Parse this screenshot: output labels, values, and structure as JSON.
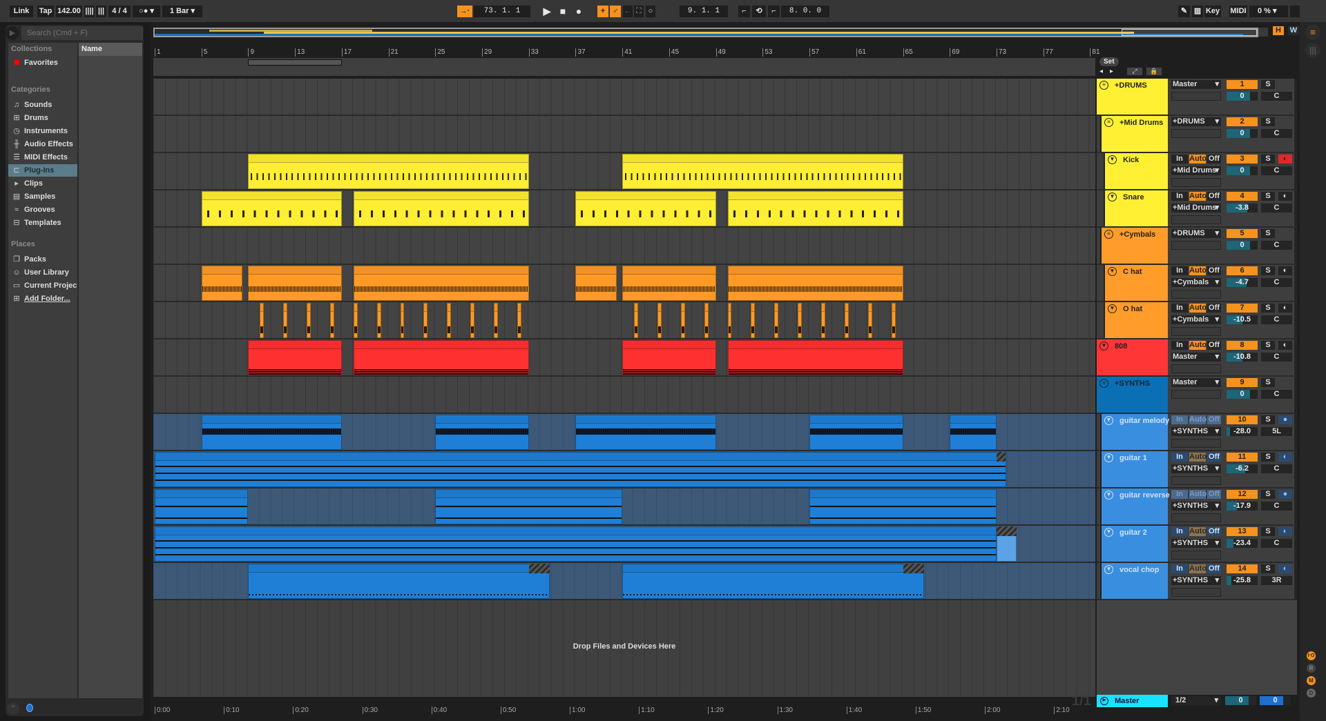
{
  "transport": {
    "link": "Link",
    "tap": "Tap",
    "tempo": "142.00",
    "sig": "4 / 4",
    "metro": "○●",
    "quant": "1 Bar",
    "position": "73.  1.  1",
    "loop_start": "9.  1.  1",
    "loop_length": "8.  0.  0",
    "key": "Key",
    "midi": "MIDI",
    "cpu": "0 %"
  },
  "browser": {
    "search_placeholder": "Search (Cmd + F)",
    "collections_heading": "Collections",
    "favorites": "Favorites",
    "categories_heading": "Categories",
    "categories": [
      {
        "label": "Sounds",
        "icon": "music-note-icon"
      },
      {
        "label": "Drums",
        "icon": "drum-grid-icon"
      },
      {
        "label": "Instruments",
        "icon": "instrument-icon"
      },
      {
        "label": "Audio Effects",
        "icon": "audio-effects-icon"
      },
      {
        "label": "MIDI Effects",
        "icon": "midi-effects-icon"
      },
      {
        "label": "Plug-Ins",
        "icon": "plugin-icon",
        "selected": true
      },
      {
        "label": "Clips",
        "icon": "clip-icon"
      },
      {
        "label": "Samples",
        "icon": "sample-icon"
      },
      {
        "label": "Grooves",
        "icon": "groove-icon"
      },
      {
        "label": "Templates",
        "icon": "template-icon"
      }
    ],
    "places_heading": "Places",
    "places": [
      {
        "label": "Packs",
        "icon": "packs-icon"
      },
      {
        "label": "User Library",
        "icon": "user-icon"
      },
      {
        "label": "Current Projec",
        "icon": "folder-icon"
      },
      {
        "label": "Add Folder...",
        "icon": "add-folder-icon"
      }
    ],
    "name_header": "Name"
  },
  "arrangement": {
    "set": "Set",
    "h": "H",
    "w": "W",
    "drop_text": "Drop Files and Devices Here",
    "fraction": "1/1",
    "ruler": [
      "1",
      "5",
      "9",
      "13",
      "17",
      "21",
      "25",
      "29",
      "33",
      "37",
      "41",
      "45",
      "49",
      "53",
      "57",
      "61",
      "65",
      "69",
      "73",
      "77",
      "81"
    ],
    "time": [
      "0:00",
      "0:10",
      "0:20",
      "0:30",
      "0:40",
      "0:50",
      "1:00",
      "1:10",
      "1:20",
      "1:30",
      "1:40",
      "1:50",
      "2:00",
      "2:10"
    ],
    "loop_bars": [
      9,
      17
    ]
  },
  "tracks": [
    {
      "name": "+DRUMS",
      "group": true,
      "depth": 0,
      "color": "#fff034",
      "num": "1",
      "vol": "0",
      "pan": "C",
      "route": "Master",
      "clips": []
    },
    {
      "name": "+Mid Drums",
      "group": true,
      "depth": 1,
      "color": "#fff034",
      "num": "2",
      "vol": "0",
      "pan": "C",
      "route": "+DRUMS",
      "clips": []
    },
    {
      "name": "Kick",
      "depth": 2,
      "color": "#fff034",
      "clip": "#ffee33",
      "num": "3",
      "vol": "0",
      "pan": "C",
      "route": "+Mid Drums",
      "io": [
        "In",
        "Auto",
        "Off"
      ],
      "arm": "red",
      "pattern": "kick",
      "clips": [
        [
          9,
          33
        ],
        [
          41,
          65
        ]
      ]
    },
    {
      "name": "Snare",
      "depth": 2,
      "color": "#fff034",
      "clip": "#ffee33",
      "num": "4",
      "vol": "-3.8",
      "pan": "C",
      "route": "+Mid Drums",
      "io": [
        "In",
        "Auto",
        "Off"
      ],
      "pattern": "snare",
      "clips": [
        [
          5,
          17
        ],
        [
          18,
          33
        ],
        [
          37,
          49
        ],
        [
          50,
          65
        ]
      ]
    },
    {
      "name": "+Cymbals",
      "group": true,
      "depth": 1,
      "color": "#ff9c2a",
      "num": "5",
      "vol": "0",
      "pan": "C",
      "route": "+DRUMS",
      "clips": []
    },
    {
      "name": "C hat",
      "depth": 2,
      "color": "#ff9c2a",
      "clip": "#ff9a26",
      "num": "6",
      "vol": "-4.7",
      "pan": "C",
      "route": "+Cymbals",
      "io": [
        "In",
        "Auto",
        "Off"
      ],
      "pattern": "hat",
      "clips": [
        [
          5,
          8.5
        ],
        [
          9,
          17
        ],
        [
          18,
          33
        ],
        [
          37,
          40.5
        ],
        [
          41,
          49
        ],
        [
          50,
          65
        ]
      ]
    },
    {
      "name": "O hat",
      "depth": 2,
      "color": "#ff9c2a",
      "clip": "#ff9a26",
      "num": "7",
      "vol": "-10.5",
      "pan": "C",
      "route": "+Cymbals",
      "io": [
        "In",
        "Auto",
        "Off"
      ],
      "pattern": "ohat",
      "clips": [
        [
          10,
          10.35
        ],
        [
          12,
          12.35
        ],
        [
          14,
          14.35
        ],
        [
          16,
          16.35
        ],
        [
          18,
          18.35
        ],
        [
          20,
          20.35
        ],
        [
          22,
          22.35
        ],
        [
          24,
          24.35
        ],
        [
          26,
          26.35
        ],
        [
          28,
          28.35
        ],
        [
          30,
          30.35
        ],
        [
          32,
          32.35
        ],
        [
          42,
          42.35
        ],
        [
          44,
          44.35
        ],
        [
          46,
          46.35
        ],
        [
          48,
          48.35
        ],
        [
          50,
          50.35
        ],
        [
          52,
          52.35
        ],
        [
          54,
          54.35
        ],
        [
          56,
          56.35
        ],
        [
          58,
          58.35
        ],
        [
          60,
          60.35
        ],
        [
          62,
          62.35
        ],
        [
          64,
          64.35
        ]
      ]
    },
    {
      "name": "808",
      "depth": 0,
      "color": "#ff3636",
      "clip": "#ff3030",
      "num": "8",
      "vol": "-10.8",
      "pan": "C",
      "route": "Master",
      "io": [
        "In",
        "Auto",
        "Off"
      ],
      "pattern": "bass",
      "clips": [
        [
          9,
          17
        ],
        [
          18,
          33
        ],
        [
          41,
          49
        ],
        [
          50,
          65
        ]
      ]
    },
    {
      "name": "+SYNTHS",
      "group": true,
      "depth": 0,
      "color": "#0a6fb5",
      "num": "9",
      "vol": "0",
      "pan": "C",
      "route": "Master",
      "clips": []
    },
    {
      "name": "guitar melody",
      "depth": 1,
      "color": "#3a8ee0",
      "clip": "#1f7fd6",
      "num": "10",
      "vol": "-28.0",
      "pan": "5L",
      "route": "+SYNTHS",
      "io": [
        "In",
        "Auto",
        "Off"
      ],
      "audio": true,
      "pattern": "wave",
      "clips": [
        [
          5,
          17
        ],
        [
          25,
          33
        ],
        [
          37,
          49
        ],
        [
          57,
          65
        ],
        [
          69,
          73
        ]
      ]
    },
    {
      "name": "guitar 1",
      "depth": 1,
      "color": "#3a8ee0",
      "clip": "#1f7fd6",
      "num": "11",
      "vol": "-6.2",
      "pan": "C",
      "route": "+SYNTHS",
      "io": [
        "In",
        "Auto",
        "Off"
      ],
      "pattern": "chords",
      "clips": [
        [
          1,
          73.8
        ]
      ],
      "hatch": [
        [
          73,
          73.8
        ]
      ]
    },
    {
      "name": "guitar reverse",
      "depth": 1,
      "color": "#3a8ee0",
      "clip": "#1f7fd6",
      "num": "12",
      "vol": "-17.9",
      "pan": "C",
      "route": "+SYNTHS",
      "io": [
        "In",
        "Auto",
        "Off"
      ],
      "audio": true,
      "pattern": "rev",
      "clips": [
        [
          1,
          9
        ],
        [
          25,
          41
        ],
        [
          57,
          73
        ]
      ]
    },
    {
      "name": "guitar 2",
      "depth": 1,
      "color": "#3a8ee0",
      "clip": "#1f7fd6",
      "num": "13",
      "vol": "-23.4",
      "pan": "C",
      "route": "+SYNTHS",
      "io": [
        "In",
        "Auto",
        "Off"
      ],
      "pattern": "chords",
      "clips": [
        [
          1,
          73
        ],
        [
          73,
          74.7
        ]
      ],
      "hatch": [
        [
          73,
          74.7
        ]
      ]
    },
    {
      "name": "vocal chop",
      "depth": 1,
      "color": "#3a8ee0",
      "clip": "#1f7fd6",
      "num": "14",
      "vol": "-25.8",
      "pan": "3R",
      "route": "+SYNTHS",
      "io": [
        "In",
        "Auto",
        "Off"
      ],
      "pattern": "vox",
      "clips": [
        [
          9,
          34.8
        ],
        [
          41,
          66.8
        ]
      ],
      "hatch": [
        [
          33,
          34.8
        ],
        [
          65,
          66.8
        ]
      ]
    }
  ],
  "master": {
    "name": "Master",
    "route": "1/2",
    "vol": "0",
    "pan": "0"
  },
  "side": {
    "io": "I·O",
    "r": "R",
    "m": "M",
    "d": "D"
  },
  "colors": {
    "accent": "#f6921e",
    "master": "#18e3ff",
    "arm_red": "#e02828"
  }
}
